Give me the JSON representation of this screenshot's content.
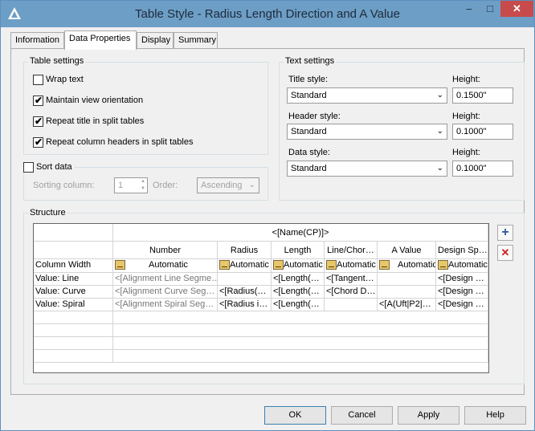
{
  "window": {
    "title": "Table Style - Radius Length Direction and A Value"
  },
  "tabs": [
    {
      "label": "Information"
    },
    {
      "label": "Data Properties"
    },
    {
      "label": "Display"
    },
    {
      "label": "Summary"
    }
  ],
  "table_settings": {
    "label": "Table settings",
    "wrap_text": {
      "label": "Wrap text",
      "checked": false
    },
    "maintain_view": {
      "label": "Maintain view orientation",
      "checked": true
    },
    "repeat_title": {
      "label": "Repeat title in split tables",
      "checked": true
    },
    "repeat_headers": {
      "label": "Repeat column headers in split tables",
      "checked": true
    }
  },
  "sort": {
    "label": "Sort data",
    "checked": false,
    "column_label": "Sorting column:",
    "column_value": "1",
    "order_label": "Order:",
    "order_value": "Ascending"
  },
  "text_settings": {
    "label": "Text settings",
    "title_style_label": "Title style:",
    "title_style": "Standard",
    "header_style_label": "Header style:",
    "header_style": "Standard",
    "data_style_label": "Data style:",
    "data_style": "Standard",
    "height_label": "Height:",
    "title_height": "0.1500\"",
    "header_height": "0.1000\"",
    "data_height": "0.1000\""
  },
  "structure": {
    "label": "Structure",
    "title_cell": "<[Name(CP)]>",
    "columns": [
      "Number",
      "Radius",
      "Length",
      "Line/Chor…",
      "A Value",
      "Design Sp…"
    ],
    "column_width_label": "Column Width",
    "widths": [
      "Automatic",
      "Automatic",
      "Automatic",
      "Automatic",
      "Automatic",
      "Automatic"
    ],
    "rows": [
      {
        "label": "Value: Line",
        "cells": [
          "<[Alignment Line Segme…",
          "",
          "<[Length(…",
          "<[Tangent…",
          "",
          "<[Design …"
        ]
      },
      {
        "label": "Value: Curve",
        "cells": [
          "<[Alignment Curve Seg…",
          "<[Radius(…",
          "<[Length(…",
          "<[Chord D…",
          "",
          "<[Design …"
        ]
      },
      {
        "label": "Value: Spiral",
        "cells": [
          "<[Alignment Spiral Seg…",
          "<[Radius i…",
          "<[Length(…",
          "",
          "<[A(Uft|P2|…",
          "<[Design …"
        ]
      }
    ]
  },
  "buttons": {
    "ok": "OK",
    "cancel": "Cancel",
    "apply": "Apply",
    "help": "Help"
  },
  "icons": {
    "window_min": "–",
    "window_max": "□",
    "window_close": "✕",
    "add": "+",
    "delete": "✕",
    "check": "✔",
    "dropdown": "⌄",
    "spin_up": "▲",
    "spin_down": "▼"
  }
}
